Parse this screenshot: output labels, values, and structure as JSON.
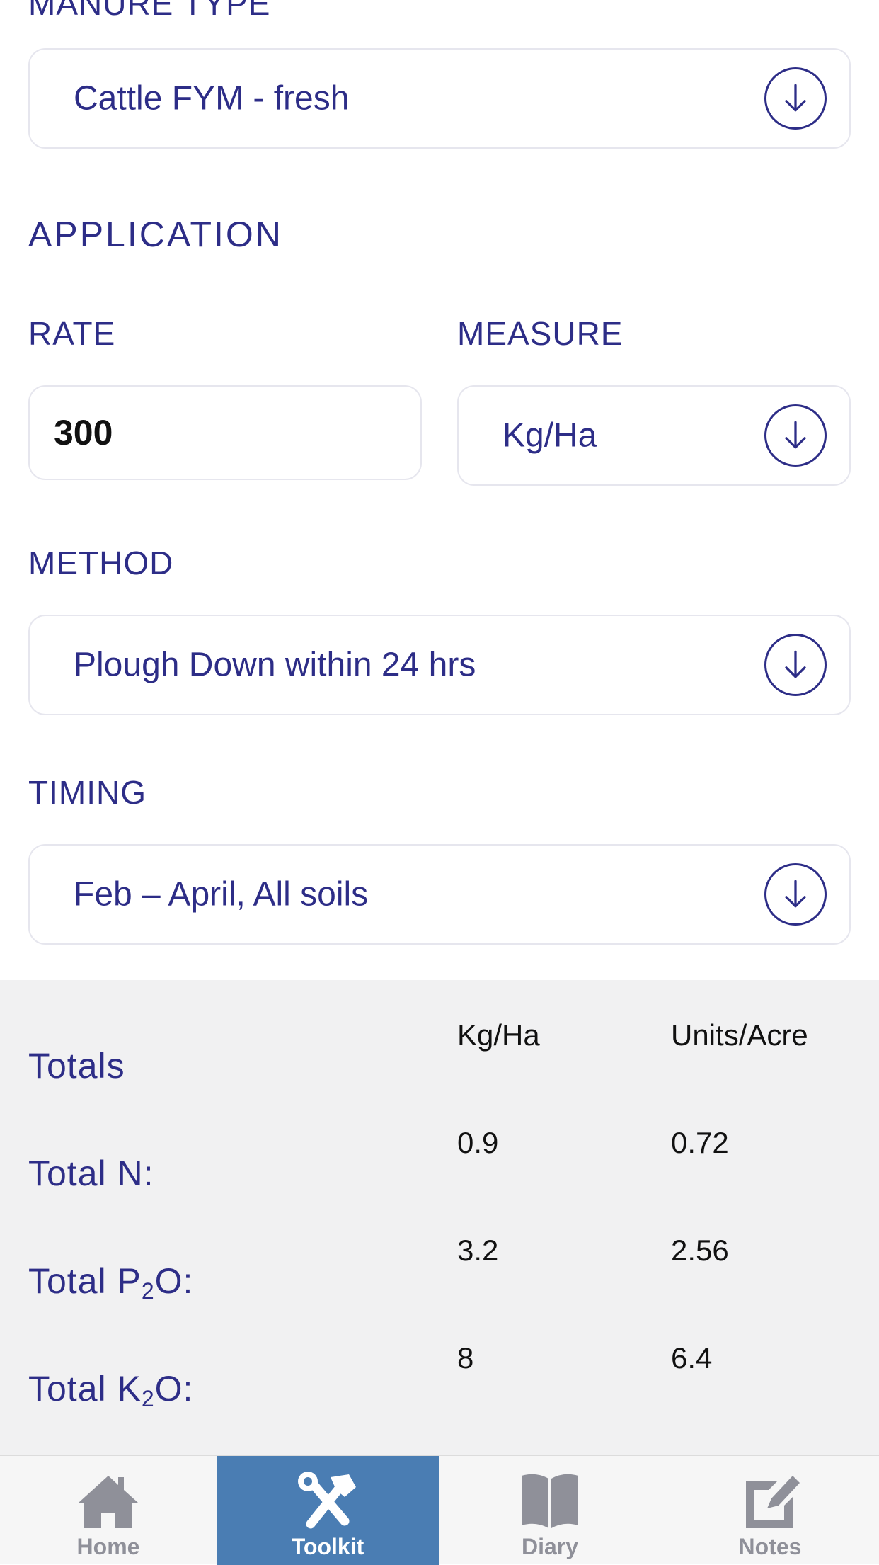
{
  "form": {
    "manure_type_label": "MANURE TYPE",
    "manure_type_value": "Cattle FYM - fresh",
    "application_heading": "APPLICATION",
    "rate_label": "RATE",
    "rate_value": "300",
    "measure_label": "MEASURE",
    "measure_value": "Kg/Ha",
    "method_label": "METHOD",
    "method_value": "Plough Down within 24 hrs",
    "timing_label": "TIMING",
    "timing_value": "Feb – April, All soils"
  },
  "totals": {
    "heading": "Totals",
    "col_kgha": "Kg/Ha",
    "col_units_acre": "Units/Acre",
    "rows": [
      {
        "label_main": "Total N:",
        "sub": "",
        "label_tail": "",
        "kgha": "0.9",
        "units_acre": "0.72"
      },
      {
        "label_main": "Total P",
        "sub": "2",
        "label_tail": "O:",
        "kgha": "3.2",
        "units_acre": "2.56"
      },
      {
        "label_main": "Total K",
        "sub": "2",
        "label_tail": "O:",
        "kgha": "8",
        "units_acre": "6.4"
      }
    ]
  },
  "tabbar": {
    "active": "Toolkit",
    "items": [
      {
        "label": "Home",
        "icon": "home-icon"
      },
      {
        "label": "Toolkit",
        "icon": "toolkit-icon"
      },
      {
        "label": "Diary",
        "icon": "book-icon"
      },
      {
        "label": "Notes",
        "icon": "edit-icon"
      }
    ]
  },
  "colors": {
    "accent_text": "#2d2d87",
    "active_tab": "#4a7db3",
    "totals_bg": "#f1f1f2",
    "inactive_tab_icon": "#8f9099"
  }
}
